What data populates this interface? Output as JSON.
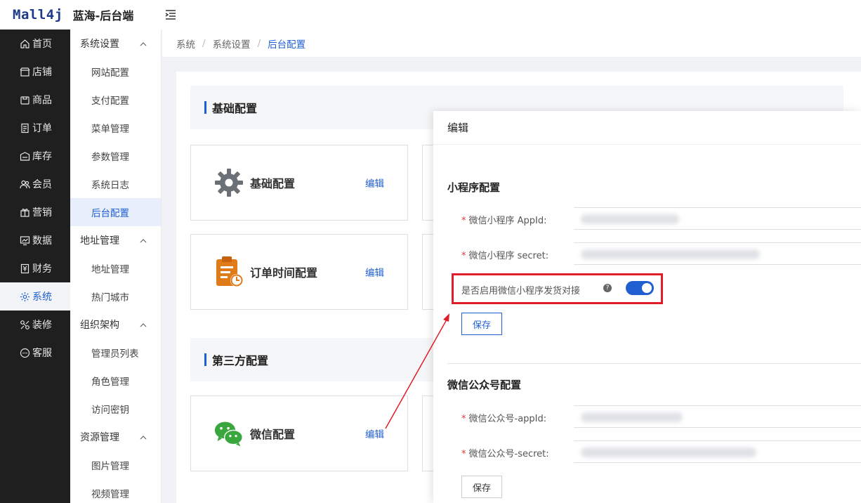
{
  "header": {
    "logo": "Mall4j",
    "app_title": "蓝海-后台端"
  },
  "main_nav": [
    {
      "label": "首页",
      "icon": "home-icon"
    },
    {
      "label": "店铺",
      "icon": "store-icon"
    },
    {
      "label": "商品",
      "icon": "goods-icon"
    },
    {
      "label": "订单",
      "icon": "order-icon"
    },
    {
      "label": "库存",
      "icon": "stock-icon"
    },
    {
      "label": "会员",
      "icon": "member-icon"
    },
    {
      "label": "营销",
      "icon": "gift-icon"
    },
    {
      "label": "数据",
      "icon": "chart-icon"
    },
    {
      "label": "财务",
      "icon": "finance-icon"
    },
    {
      "label": "系统",
      "icon": "gear-icon",
      "active": true
    },
    {
      "label": "装修",
      "icon": "decorate-icon"
    },
    {
      "label": "客服",
      "icon": "chat-icon"
    }
  ],
  "sub_nav": [
    {
      "type": "group",
      "label": "系统设置"
    },
    {
      "type": "item",
      "label": "网站配置"
    },
    {
      "type": "item",
      "label": "支付配置"
    },
    {
      "type": "item",
      "label": "菜单管理"
    },
    {
      "type": "item",
      "label": "参数管理"
    },
    {
      "type": "item",
      "label": "系统日志"
    },
    {
      "type": "item",
      "label": "后台配置",
      "active": true
    },
    {
      "type": "group",
      "label": "地址管理"
    },
    {
      "type": "item",
      "label": "地址管理"
    },
    {
      "type": "item",
      "label": "热门城市"
    },
    {
      "type": "group",
      "label": "组织架构"
    },
    {
      "type": "item",
      "label": "管理员列表"
    },
    {
      "type": "item",
      "label": "角色管理"
    },
    {
      "type": "item",
      "label": "访问密钥"
    },
    {
      "type": "group",
      "label": "资源管理"
    },
    {
      "type": "item",
      "label": "图片管理"
    },
    {
      "type": "item",
      "label": "视频管理"
    }
  ],
  "breadcrumb": [
    "系统",
    "系统设置",
    "后台配置"
  ],
  "sections": {
    "basic": "基础配置",
    "third_party": "第三方配置"
  },
  "cards": {
    "basic": {
      "title": "基础配置",
      "edit": "编辑"
    },
    "order_time": {
      "title": "订单时间配置",
      "edit": "编辑"
    },
    "wechat": {
      "title": "微信配置",
      "edit": "编辑"
    }
  },
  "dialog": {
    "title": "编辑",
    "mini_program_section": "小程序配置",
    "mp_appid_label": "微信小程序 AppId:",
    "mp_secret_label": "微信小程序 secret:",
    "shipping_toggle_label": "是否启用微信小程序发货对接",
    "shipping_toggle_on": true,
    "help_mark": "?",
    "save_label": "保存",
    "official_section": "微信公众号配置",
    "oa_appid_label": "微信公众号-appId:",
    "oa_secret_label": "微信公众号-secret:",
    "save_label_2": "保存"
  },
  "colors": {
    "accent": "#1f5fd1",
    "highlight": "#e11d2a",
    "nav_bg": "#1f1f1f"
  }
}
